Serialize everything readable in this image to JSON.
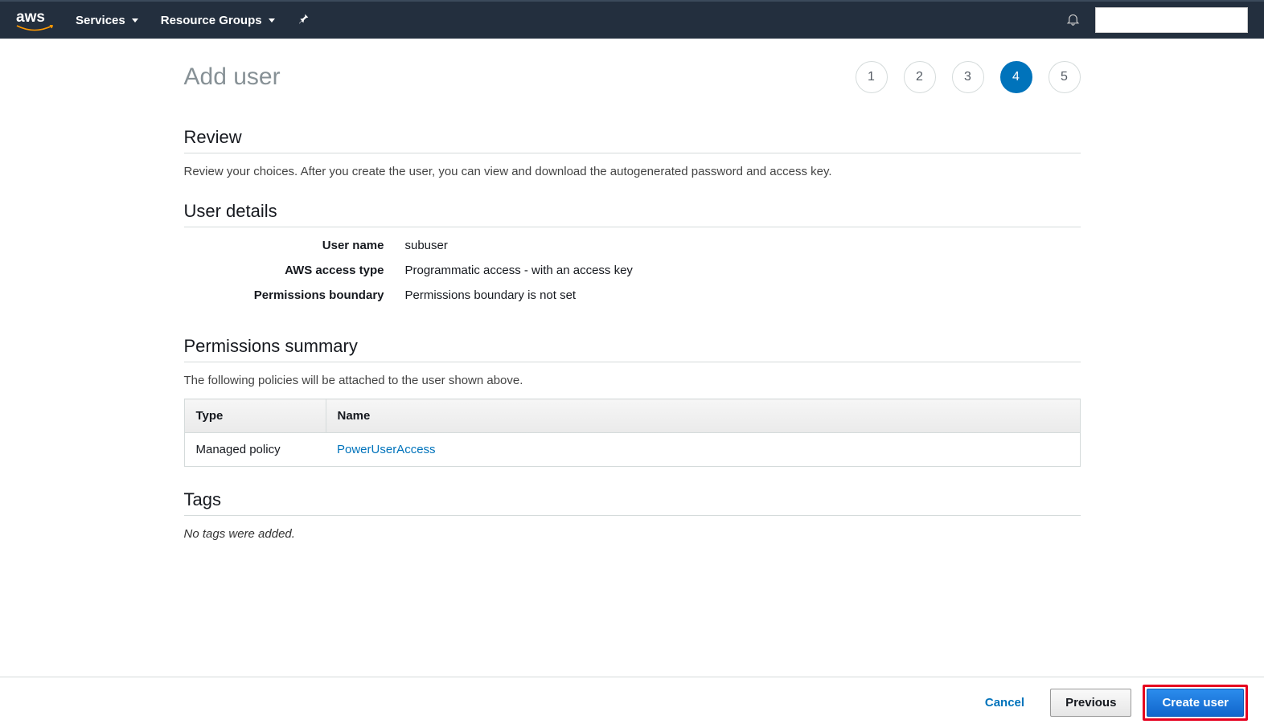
{
  "header": {
    "logo": "aws",
    "nav": {
      "services": "Services",
      "resource_groups": "Resource Groups"
    }
  },
  "page": {
    "title": "Add user",
    "steps": [
      "1",
      "2",
      "3",
      "4",
      "5"
    ],
    "active_step": 4
  },
  "review": {
    "title": "Review",
    "desc": "Review your choices. After you create the user, you can view and download the autogenerated password and access key."
  },
  "user_details": {
    "title": "User details",
    "rows": {
      "username_label": "User name",
      "username_value": "subuser",
      "access_label": "AWS access type",
      "access_value": "Programmatic access - with an access key",
      "boundary_label": "Permissions boundary",
      "boundary_value": "Permissions boundary is not set"
    }
  },
  "permissions": {
    "title": "Permissions summary",
    "desc": "The following policies will be attached to the user shown above.",
    "columns": {
      "type": "Type",
      "name": "Name"
    },
    "rows": [
      {
        "type": "Managed policy",
        "name": "PowerUserAccess"
      }
    ]
  },
  "tags": {
    "title": "Tags",
    "empty": "No tags were added."
  },
  "footer": {
    "cancel": "Cancel",
    "previous": "Previous",
    "create": "Create user"
  }
}
